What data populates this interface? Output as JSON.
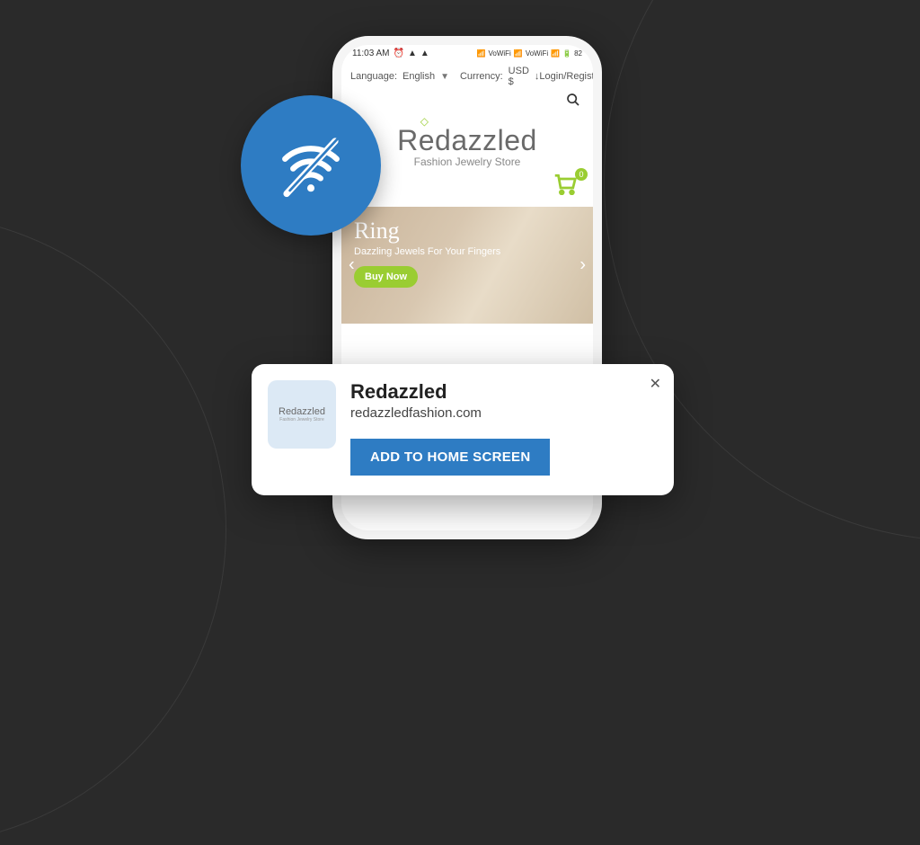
{
  "statusbar": {
    "time": "11:03 AM",
    "battery": "82"
  },
  "topbar": {
    "language_label": "Language:",
    "language_value": "English",
    "currency_label": "Currency:",
    "currency_value": "USD $",
    "login_label": "Login/Register"
  },
  "logo": {
    "r": "R",
    "e": "e",
    "rest": "dazzled",
    "tagline": "Fashion Jewelry Store"
  },
  "cart": {
    "count": "0"
  },
  "hero": {
    "title": "Ring",
    "subtitle": "Dazzling Jewels For Your Fingers",
    "button": "Buy Now"
  },
  "dialog": {
    "app_name": "Redazzled",
    "domain": "redazzledfashion.com",
    "button": "ADD TO HOME SCREEN",
    "icon_title": "Redazzled",
    "icon_sub": "Fashion Jewelry Store"
  }
}
